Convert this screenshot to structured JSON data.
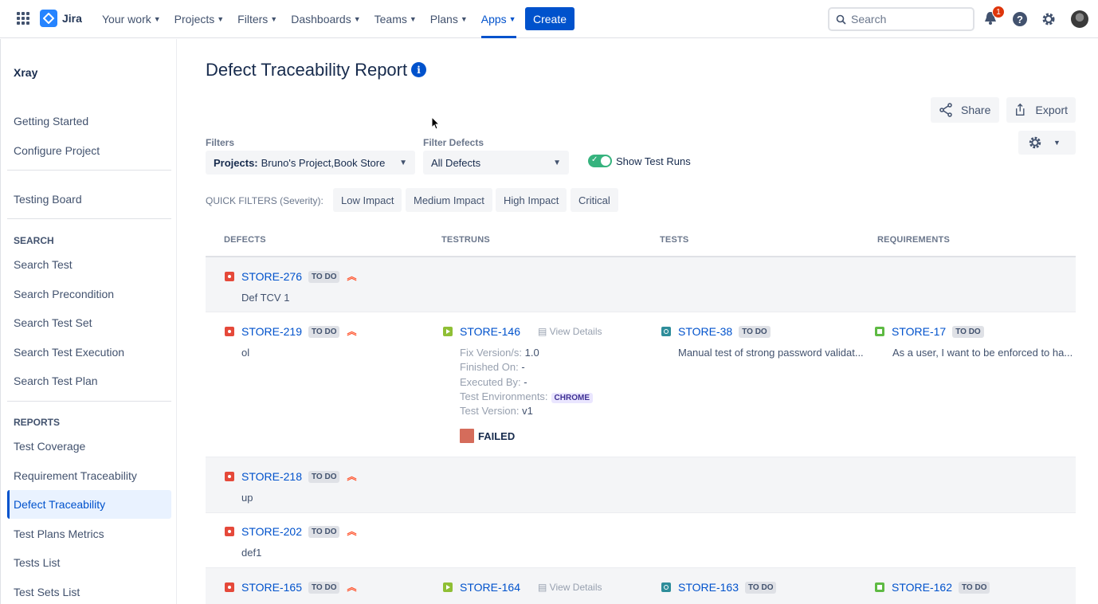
{
  "nav": {
    "app_name": "Jira",
    "items": [
      {
        "label": "Your work",
        "active": false
      },
      {
        "label": "Projects",
        "active": false
      },
      {
        "label": "Filters",
        "active": false
      },
      {
        "label": "Dashboards",
        "active": false
      },
      {
        "label": "Teams",
        "active": false
      },
      {
        "label": "Plans",
        "active": false
      },
      {
        "label": "Apps",
        "active": true
      }
    ],
    "create_label": "Create",
    "search_placeholder": "Search",
    "notification_count": "1"
  },
  "sidebar": {
    "title": "Xray",
    "getting_started": "Getting Started",
    "configure_project": "Configure Project",
    "testing_board": "Testing Board",
    "search_section": "SEARCH",
    "search_items": [
      "Search Test",
      "Search Precondition",
      "Search Test Set",
      "Search Test Execution",
      "Search Test Plan"
    ],
    "reports_section": "REPORTS",
    "report_items": [
      "Test Coverage",
      "Requirement Traceability",
      "Defect Traceability",
      "Test Plans Metrics",
      "Tests List",
      "Test Sets List"
    ],
    "active_item": "Defect Traceability"
  },
  "main": {
    "title": "Defect Traceability Report",
    "share_label": "Share",
    "export_label": "Export",
    "filters_label": "Filters",
    "projects_prefix": "Projects:",
    "projects_value": "Bruno's Project,Book Store",
    "filter_defects_label": "Filter Defects",
    "filter_defects_value": "All Defects",
    "show_test_runs_label": "Show Test Runs",
    "show_test_runs_on": true,
    "quick_filters_label": "QUICK FILTERS (Severity):",
    "quick_filters": [
      "Low Impact",
      "Medium Impact",
      "High Impact",
      "Critical"
    ],
    "columns": [
      "DEFECTS",
      "TESTRUNS",
      "TESTS",
      "REQUIREMENTS"
    ],
    "status_todo": "TO DO",
    "view_details": "View Details",
    "rows": [
      {
        "defect_key": "STORE-276",
        "defect_summary": "Def TCV 1"
      },
      {
        "defect_key": "STORE-219",
        "defect_summary": "ol",
        "testrun_key": "STORE-146",
        "details": {
          "fix_version_label": "Fix Version/s:",
          "fix_version_value": "1.0",
          "finished_on_label": "Finished On:",
          "finished_on_value": "-",
          "executed_by_label": "Executed By:",
          "executed_by_value": "-",
          "test_env_label": "Test Environments:",
          "test_env_value": "CHROME",
          "test_version_label": "Test Version:",
          "test_version_value": "v1"
        },
        "run_status": "FAILED",
        "test_key": "STORE-38",
        "test_summary": "Manual test of strong password validat...",
        "req_key": "STORE-17",
        "req_summary": "As a user, I want to be enforced to ha..."
      },
      {
        "defect_key": "STORE-218",
        "defect_summary": "up"
      },
      {
        "defect_key": "STORE-202",
        "defect_summary": "def1"
      },
      {
        "defect_key": "STORE-165",
        "testrun_key": "STORE-164",
        "test_key": "STORE-163",
        "req_key": "STORE-162"
      }
    ]
  },
  "colors": {
    "primary": "#0052CC",
    "bug": "#E5493A",
    "toggle_on": "#36B37E",
    "failed": "#D56C5B"
  }
}
